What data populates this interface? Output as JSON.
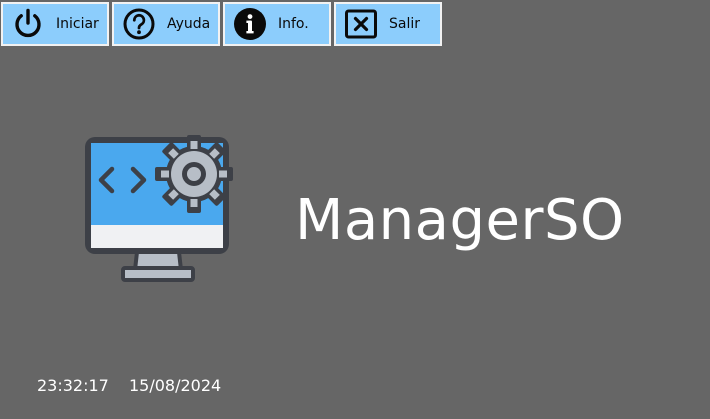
{
  "toolbar": {
    "buttons": [
      {
        "label": "Iniciar",
        "icon": "power-icon"
      },
      {
        "label": "Ayuda",
        "icon": "help-circle-icon"
      },
      {
        "label": "Info.",
        "icon": "info-circle-icon"
      },
      {
        "label": "Salir",
        "icon": "close-box-icon"
      }
    ]
  },
  "main": {
    "logo_icon": "monitor-code-gear-icon",
    "app_title": "ManagerSO"
  },
  "status": {
    "time": "23:32:17",
    "date": "15/08/2024"
  },
  "colors": {
    "background": "#666666",
    "button_fill": "#8ccdfc",
    "button_border": "#f2f2f2",
    "logo_screen": "#4aa8ee",
    "logo_frame": "#3d4047"
  }
}
